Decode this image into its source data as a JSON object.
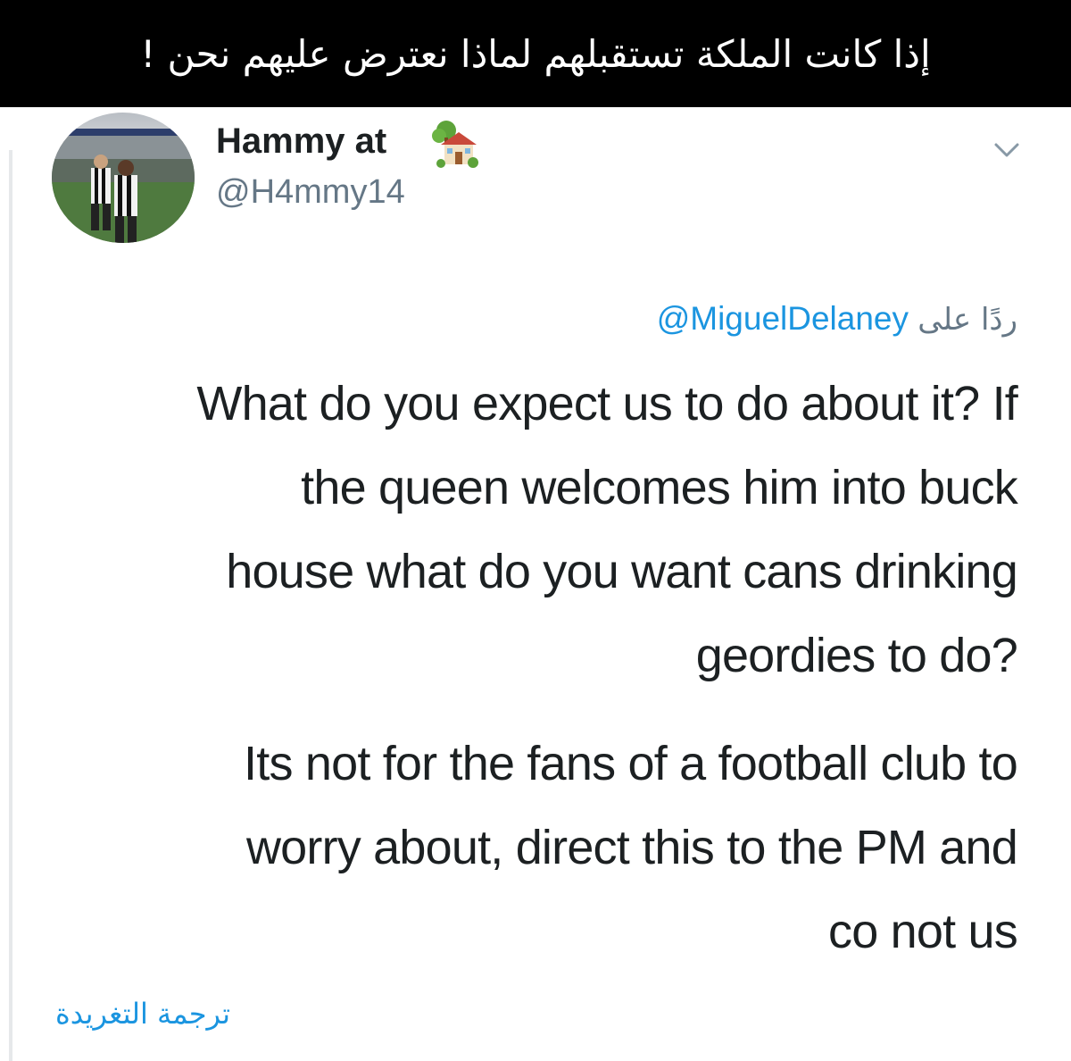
{
  "caption": {
    "text": "إذا كانت الملكة تستقبلهم لماذا نعترض عليهم نحن !"
  },
  "tweet": {
    "author": {
      "name": "Hammy at",
      "name_emoji_icon": "house-with-garden-icon",
      "handle": "@H4mmy14",
      "avatar_icon": "stadium-photo-avatar"
    },
    "reply": {
      "prefix": "ردًا على",
      "mention": "@MiguelDelaney"
    },
    "paragraphs": [
      {
        "lines": [
          "What do you expect us to do about it? If",
          "the queen welcomes him into buck",
          "house what do you want cans drinking",
          "geordies to do?"
        ]
      },
      {
        "lines": [
          "Its not for the fans of a football club to",
          "worry about, direct this to the PM and",
          "co not us"
        ]
      }
    ],
    "translate_label": "ترجمة التغريدة",
    "menu_icon": "chevron-down-icon"
  },
  "colors": {
    "banner_bg": "#000000",
    "banner_text": "#ffffff",
    "text_primary": "#1c2022",
    "text_secondary": "#657786",
    "link": "#1b95e0"
  }
}
